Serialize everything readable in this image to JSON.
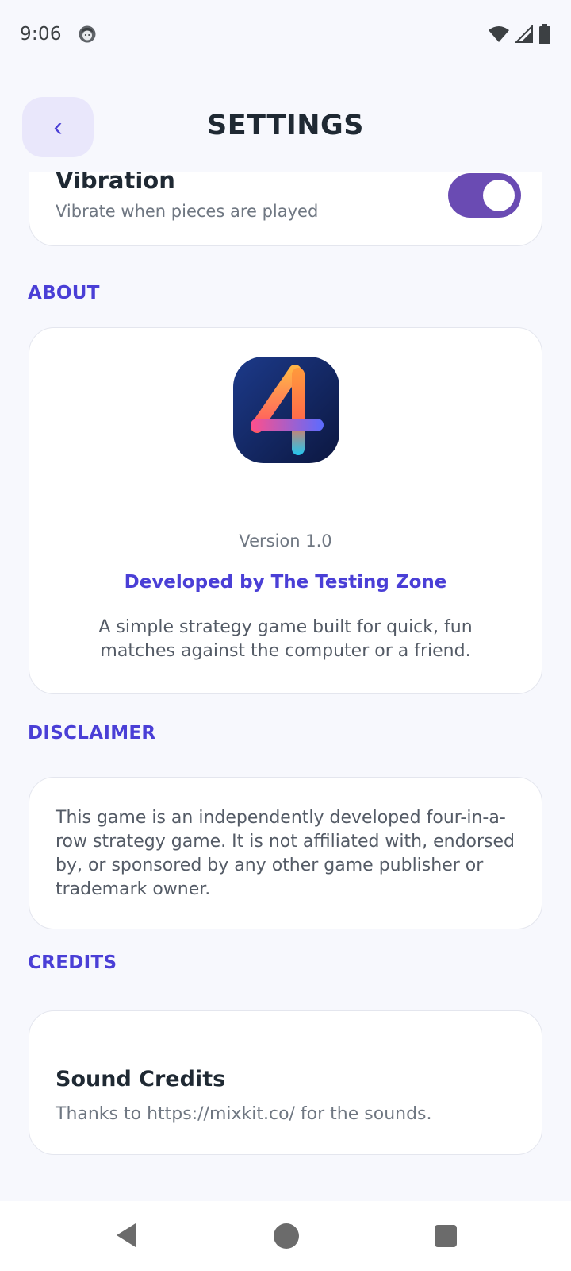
{
  "status_bar": {
    "time": "9:06",
    "icons": [
      "face-icon",
      "wifi-icon",
      "signal-icon",
      "battery-icon"
    ]
  },
  "header": {
    "title": "SETTINGS",
    "back_icon": "‹"
  },
  "vibration": {
    "title": "Vibration",
    "subtitle": "Vibrate when pieces are played",
    "enabled": true
  },
  "about": {
    "section_label": "ABOUT",
    "version": "Version 1.0",
    "developer": "Developed by The Testing Zone",
    "description": "A simple strategy game built for quick, fun matches against the computer or a friend."
  },
  "disclaimer": {
    "section_label": "DISCLAIMER",
    "text": "This game is an independently developed four-in-a-row strategy game. It is not affiliated with, endorsed by, or sponsored by any other game publisher or trademark owner."
  },
  "credits": {
    "section_label": "CREDITS",
    "title": "Sound Credits",
    "subtitle": "Thanks to https://mixkit.co/ for the sounds."
  },
  "colors": {
    "accent": "#4a3fd6",
    "toggle_on": "#6a4bb3",
    "background": "#f7f8fd"
  }
}
